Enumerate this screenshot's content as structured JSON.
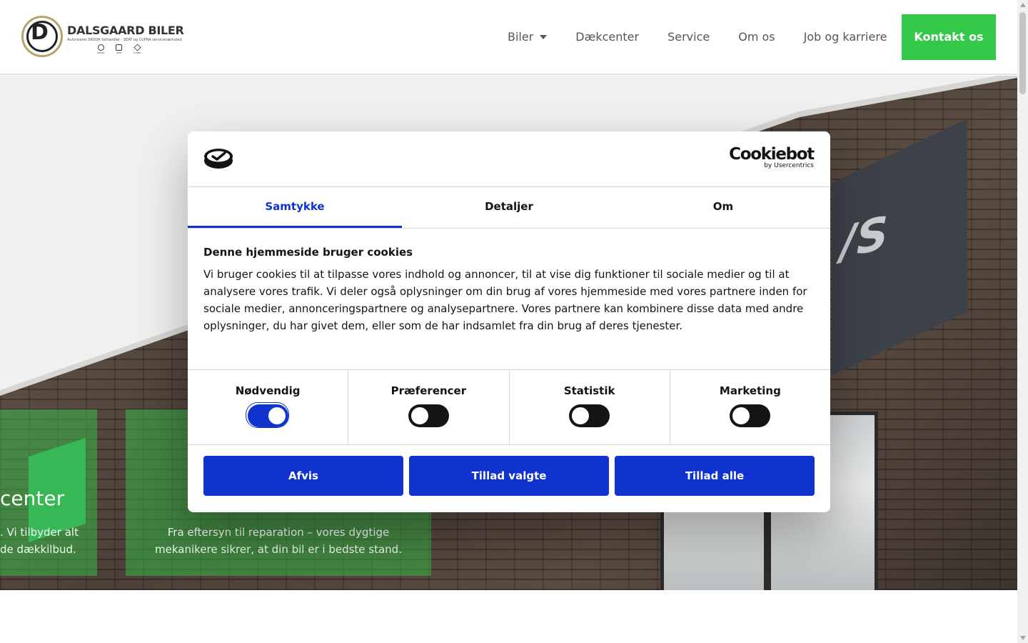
{
  "header": {
    "logo": {
      "name": "DALSGAARD BILER",
      "tagline": "Autoriseret SKODA forhandler · SEAT og CUPRA serviceværksted",
      "brands": [
        "SKODA",
        "SEAT",
        "CUPRA"
      ]
    },
    "nav": [
      {
        "label": "Biler",
        "has_dropdown": true
      },
      {
        "label": "Dækcenter"
      },
      {
        "label": "Service"
      },
      {
        "label": "Om os"
      },
      {
        "label": "Job og karriere"
      }
    ],
    "cta_label": "Kontakt os"
  },
  "hero": {
    "sign_text": "/S",
    "cards": [
      {
        "title": "center",
        "text_line1": ". Vi tilbyder alt",
        "text_line2": "de dækkilbud."
      },
      {
        "text_line1": "Fra eftersyn til reparation – vores dygtige",
        "text_line2": "mekanikere sikrer, at din bil er i bedste stand."
      }
    ]
  },
  "cookie_dialog": {
    "brand_main": "Cookiebot",
    "brand_sub": "by Usercentrics",
    "tabs": [
      {
        "label": "Samtykke",
        "active": true
      },
      {
        "label": "Detaljer",
        "active": false
      },
      {
        "label": "Om",
        "active": false
      }
    ],
    "title": "Denne hjemmeside bruger cookies",
    "text": "Vi bruger cookies til at tilpasse vores indhold og annoncer, til at vise dig funktioner til sociale medier og til at analysere vores trafik. Vi deler også oplysninger om din brug af vores hjemmeside med vores partnere inden for sociale medier, annonceringspartnere og analysepartnere. Vores partnere kan kombinere disse data med andre oplysninger, du har givet dem, eller som de har indsamlet fra din brug af deres tjenester.",
    "toggles": [
      {
        "label": "Nødvendig",
        "on": true
      },
      {
        "label": "Præferencer",
        "on": false
      },
      {
        "label": "Statistik",
        "on": false
      },
      {
        "label": "Marketing",
        "on": false
      }
    ],
    "buttons": {
      "reject": "Afvis",
      "allow_selected": "Tillad valgte",
      "allow_all": "Tillad alle"
    }
  },
  "colors": {
    "accent_green": "#35c94a",
    "cookie_blue": "#1032cf"
  }
}
